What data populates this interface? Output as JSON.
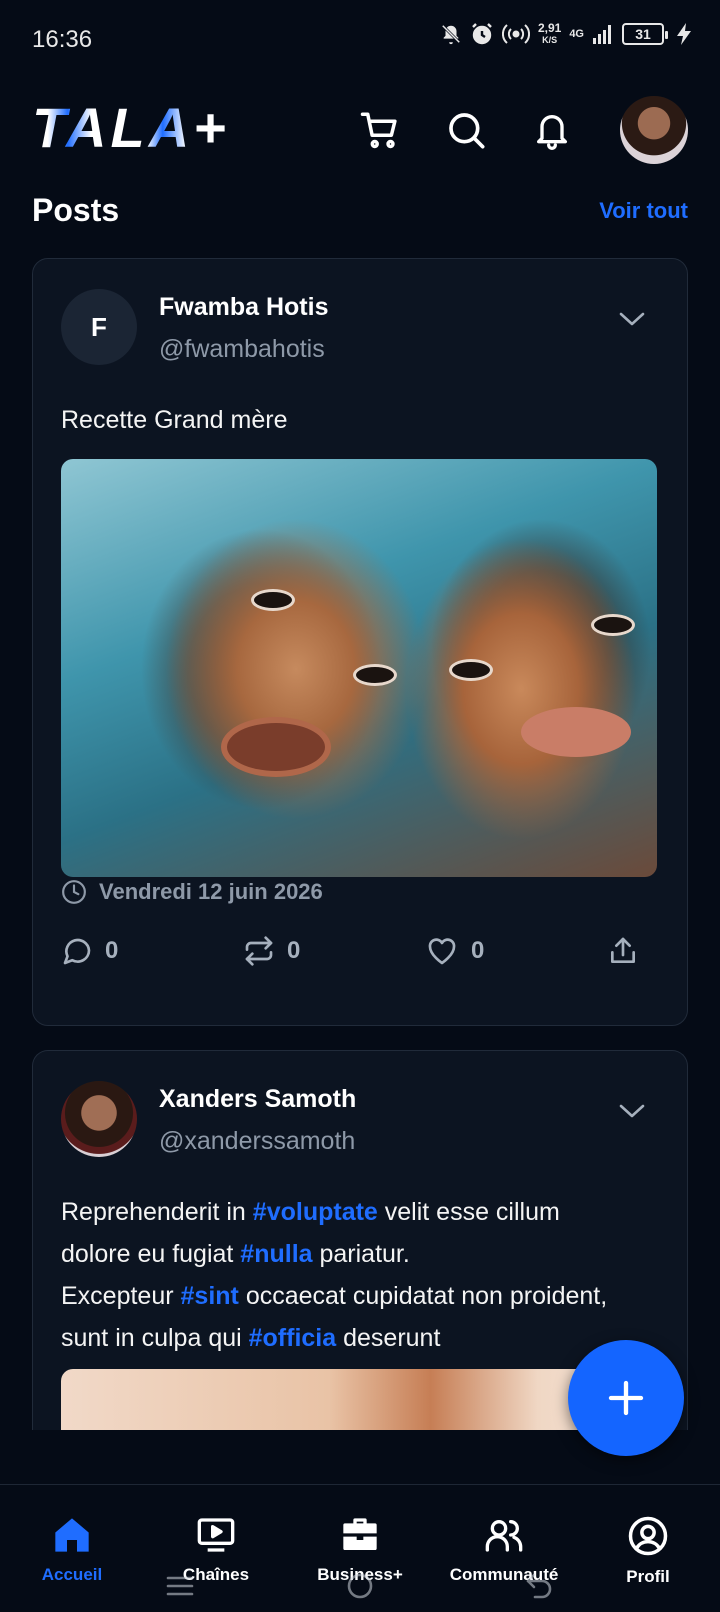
{
  "status_bar": {
    "time": "16:36",
    "net_speed_value": "2,91",
    "net_speed_unit": "K/S",
    "net_type": "4G",
    "battery": "31",
    "icons": [
      "mute-icon",
      "alarm-icon",
      "hotspot-icon",
      "signal-icon",
      "battery-icon",
      "charging-icon"
    ]
  },
  "header": {
    "logo_text": "TALA+",
    "icons": [
      "cart-icon",
      "search-icon",
      "bell-icon",
      "avatar"
    ]
  },
  "section": {
    "title": "Posts",
    "see_all": "Voir tout"
  },
  "posts": [
    {
      "avatar_initial": "F",
      "name": "Fwamba Hotis",
      "handle": "@fwambahotis",
      "text": "Recette Grand mère",
      "date": "Vendredi 12 juin 2026",
      "comments": "0",
      "reposts": "0",
      "likes": "0"
    },
    {
      "name": "Xanders Samoth",
      "handle": "@xanderssamoth",
      "text_parts": [
        {
          "t": "Reprehenderit in ",
          "tag": false
        },
        {
          "t": "#voluptate",
          "tag": true
        },
        {
          "t": " velit esse cillum dolore eu fugiat ",
          "tag": false
        },
        {
          "t": "#nulla",
          "tag": true
        },
        {
          "t": " pariatur.",
          "tag": false
        },
        {
          "t": "Excepteur ",
          "tag": false
        },
        {
          "t": "#sint",
          "tag": true
        },
        {
          "t": " occaecat cupidatat non proident, sunt in culpa qui ",
          "tag": false
        },
        {
          "t": "#officia",
          "tag": true
        },
        {
          "t": " deserunt",
          "tag": false
        }
      ]
    }
  ],
  "bottom_nav": [
    {
      "label": "Accueil",
      "icon": "home-icon",
      "active": true
    },
    {
      "label": "Chaînes",
      "icon": "tv-icon",
      "active": false
    },
    {
      "label": "Business+",
      "icon": "briefcase-icon",
      "active": false
    },
    {
      "label": "Communauté",
      "icon": "community-icon",
      "active": false
    },
    {
      "label": "Profil",
      "icon": "profile-icon",
      "active": false
    }
  ],
  "colors": {
    "accent": "#1f6dff",
    "background": "#050b16",
    "card": "#0c1421",
    "muted": "#8e99a8"
  }
}
